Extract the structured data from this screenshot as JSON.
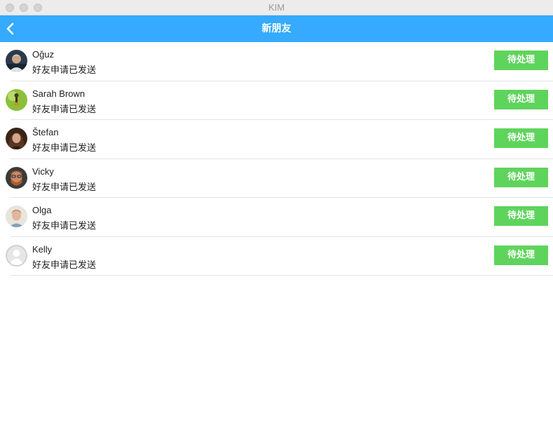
{
  "window": {
    "title": "KIM"
  },
  "navbar": {
    "title": "新朋友",
    "back_icon": "chevron-left-icon"
  },
  "colors": {
    "navbar": "#35aaff",
    "button": "#5fd45c"
  },
  "requests": [
    {
      "name": "Oğuz",
      "status": "好友申请已发送",
      "action": "待处理",
      "avatar": "photo-avatar-1"
    },
    {
      "name": "Sarah Brown",
      "status": "好友申请已发送",
      "action": "待处理",
      "avatar": "photo-avatar-2"
    },
    {
      "name": "Štefan",
      "status": "好友申请已发送",
      "action": "待处理",
      "avatar": "photo-avatar-3"
    },
    {
      "name": "Vicky",
      "status": "好友申请已发送",
      "action": "待处理",
      "avatar": "photo-avatar-4"
    },
    {
      "name": "Olga",
      "status": "好友申请已发送",
      "action": "待处理",
      "avatar": "photo-avatar-5"
    },
    {
      "name": "Kelly",
      "status": "好友申请已发送",
      "action": "待处理",
      "avatar": "default-person-icon"
    }
  ]
}
